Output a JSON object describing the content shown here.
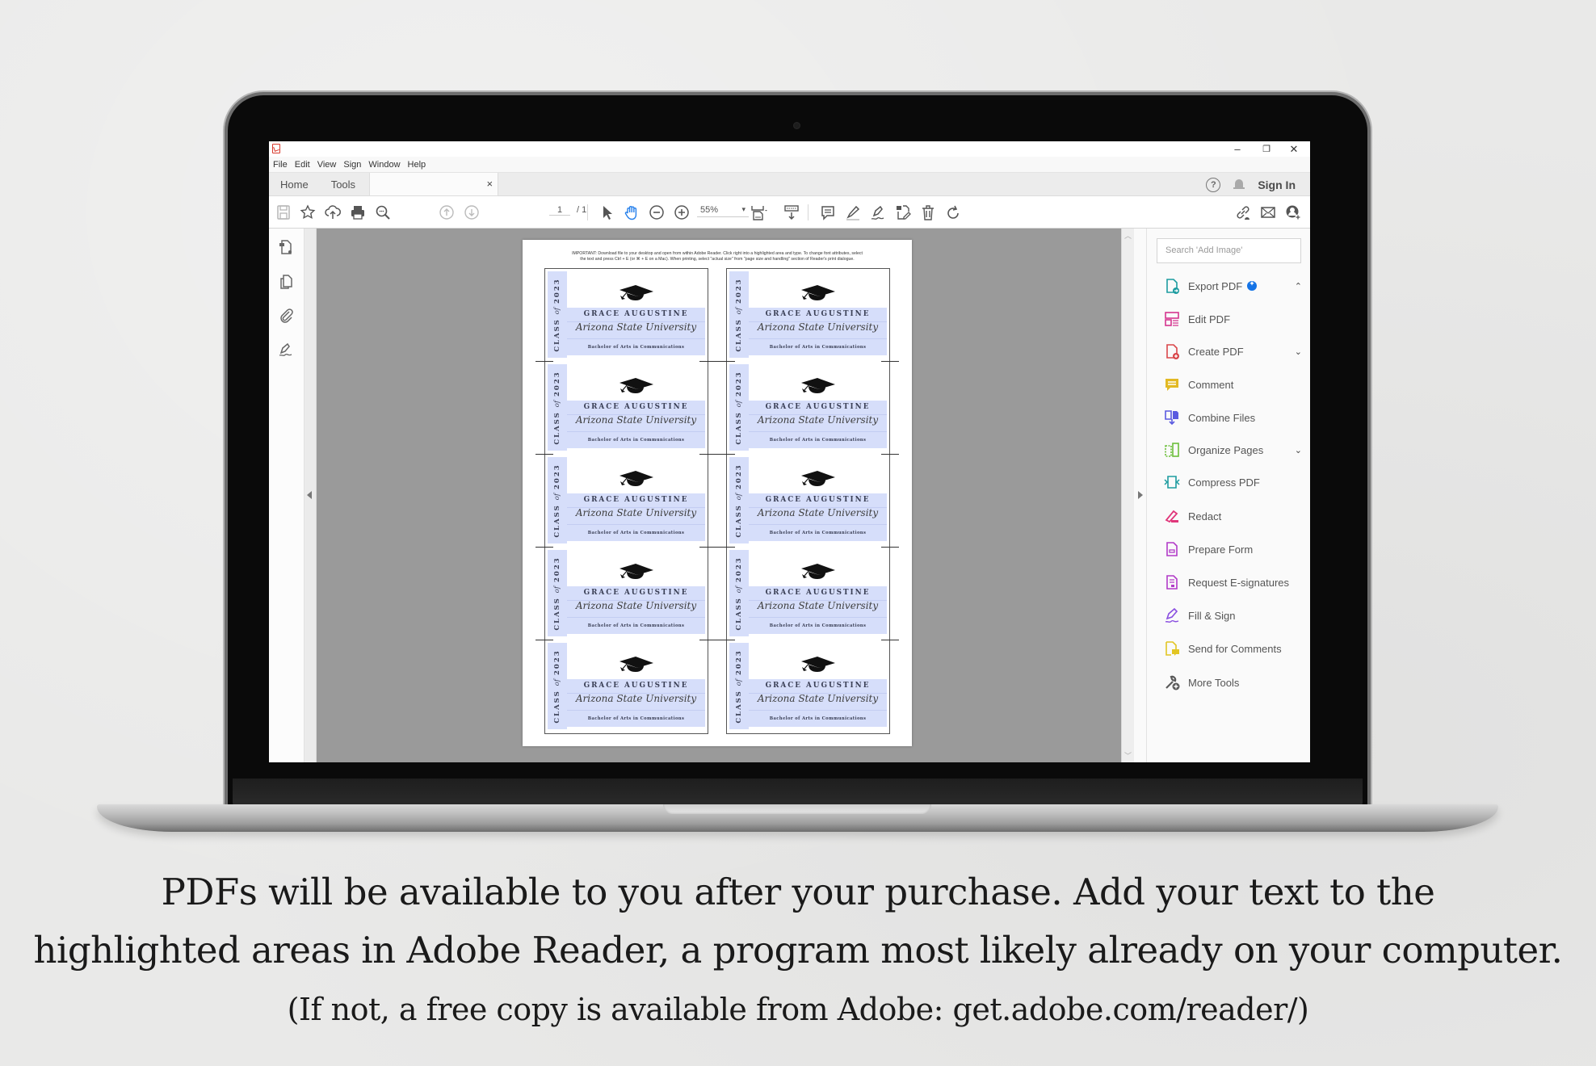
{
  "window": {
    "app_icon": "acrobat-icon",
    "controls": {
      "minimize": "–",
      "restore": "❐",
      "close": "✕"
    }
  },
  "menubar": [
    "File",
    "Edit",
    "View",
    "Sign",
    "Window",
    "Help"
  ],
  "tabs": {
    "home": "Home",
    "tools": "Tools",
    "doc_close": "×",
    "help": "?",
    "sign_in": "Sign In"
  },
  "toolbar": {
    "page_current": "1",
    "page_total": "/ 1",
    "zoom": "55%",
    "zoom_caret": "▾",
    "active_tool": "hand-tool",
    "accent": "#2680eb"
  },
  "right_pane": {
    "search_placeholder": "Search 'Add Image'",
    "tools": [
      {
        "label": "Export PDF",
        "icon": "export-pdf-icon",
        "color": "#1d9ca0",
        "badge": true,
        "chevron": "⌃"
      },
      {
        "label": "Edit PDF",
        "icon": "edit-pdf-icon",
        "color": "#d4358f"
      },
      {
        "label": "Create PDF",
        "icon": "create-pdf-icon",
        "color": "#d9474b",
        "chevron": "⌄"
      },
      {
        "label": "Comment",
        "icon": "comment-icon",
        "color": "#e2b923"
      },
      {
        "label": "Combine Files",
        "icon": "combine-files-icon",
        "color": "#5b5be0"
      },
      {
        "label": "Organize Pages",
        "icon": "organize-pages-icon",
        "color": "#6cbf3a",
        "chevron": "⌄"
      },
      {
        "label": "Compress PDF",
        "icon": "compress-pdf-icon",
        "color": "#1d9ca0"
      },
      {
        "label": "Redact",
        "icon": "redact-icon",
        "color": "#e0367a"
      },
      {
        "label": "Prepare Form",
        "icon": "prepare-form-icon",
        "color": "#b23bc8"
      },
      {
        "label": "Request E-signatures",
        "icon": "request-esignatures-icon",
        "color": "#b23bc8"
      },
      {
        "label": "Fill & Sign",
        "icon": "fill-sign-icon",
        "color": "#8a4fe0"
      },
      {
        "label": "Send for Comments",
        "icon": "send-for-comments-icon",
        "color": "#e2c523"
      },
      {
        "label": "More Tools",
        "icon": "more-tools-icon",
        "color": "#5a5a5a"
      }
    ]
  },
  "document": {
    "notice_line1": "IMPORTANT: Download file to your desktop and open from within Adobe Reader. Click right into a highlighted area and type. To change font attributes, select",
    "notice_line2": "the text and press Ctrl + E (or ⌘ + E on a Mac). When printing, select \"actual size\" from \"page size and handling\" section of Reader's print dialogue.",
    "card": {
      "class_label": "CLASS",
      "class_of": "of",
      "class_year": "2023",
      "name": "GRACE AUGUSTINE",
      "school": "Arizona State University",
      "degree": "Bachelor of Arts in Communications",
      "highlight_color": "#d6defa"
    },
    "columns": 2,
    "rows": 5
  },
  "caption": {
    "line1": "PDFs will be available to you after your purchase.  Add your text to the",
    "line2": "highlighted areas in Adobe Reader, a program most likely already on your computer.",
    "line3": "(If not, a free copy is available from Adobe: get.adobe.com/reader/)"
  }
}
